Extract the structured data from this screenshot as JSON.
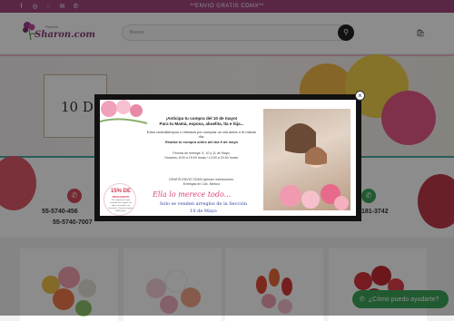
{
  "topbar": {
    "promo": "**ENVIO GRATIS CDMX**",
    "icons": [
      "facebook-icon",
      "instagram-icon",
      "whatsapp-icon",
      "mail-icon",
      "phone-icon"
    ],
    "bg": "#a2487d"
  },
  "header": {
    "logo_text": "Sharon.com",
    "logo_sub": "Florería",
    "search_placeholder": "Buscar",
    "search_icon": "search-icon",
    "cart_icon": "shopping-bag-icon"
  },
  "hero": {
    "banner_text": "10 D"
  },
  "contact": {
    "phone_1": "55-5740-456",
    "phone_2": "55-5740-7007",
    "whatsapp": "181-3742"
  },
  "chat": {
    "label": "¿Cómo puedo ayudarte?"
  },
  "modal": {
    "headline_1": "¡Anticipa tu compra del 10 de mayo!",
    "headline_2": "Para tu Mamá, esposa, abuelita, tía e hija...",
    "line_avoid": "Evita contratiempos o retrasos por comprar un día antes o el mismo día.",
    "line_before": "Realiza tu compra antes del día 9 de mayo",
    "delivery_1": "Fechas de entrega: 9, 10 y 11 de Mayo.",
    "delivery_2": "Horarios: 8:00 a 15:00 horas / 14:00 a 20:00 horas.",
    "free_1": "GRATIS ENVIO CDMX Aplican restricciones.",
    "free_2": "Entregas en Cdx. Mexico",
    "script": "Ella lo merece todo...",
    "note_1": "Solo se venden arreglos de la Sección",
    "note_2": "10 de Mayo",
    "badge_pct": "15% DE",
    "badge_label": "DESCUENTO",
    "badge_fine": "En tu siguiente compra enviando foto y tagueo. No aplica en producto con descuento. Compras mayores a $800 pesos.",
    "close": "×"
  }
}
